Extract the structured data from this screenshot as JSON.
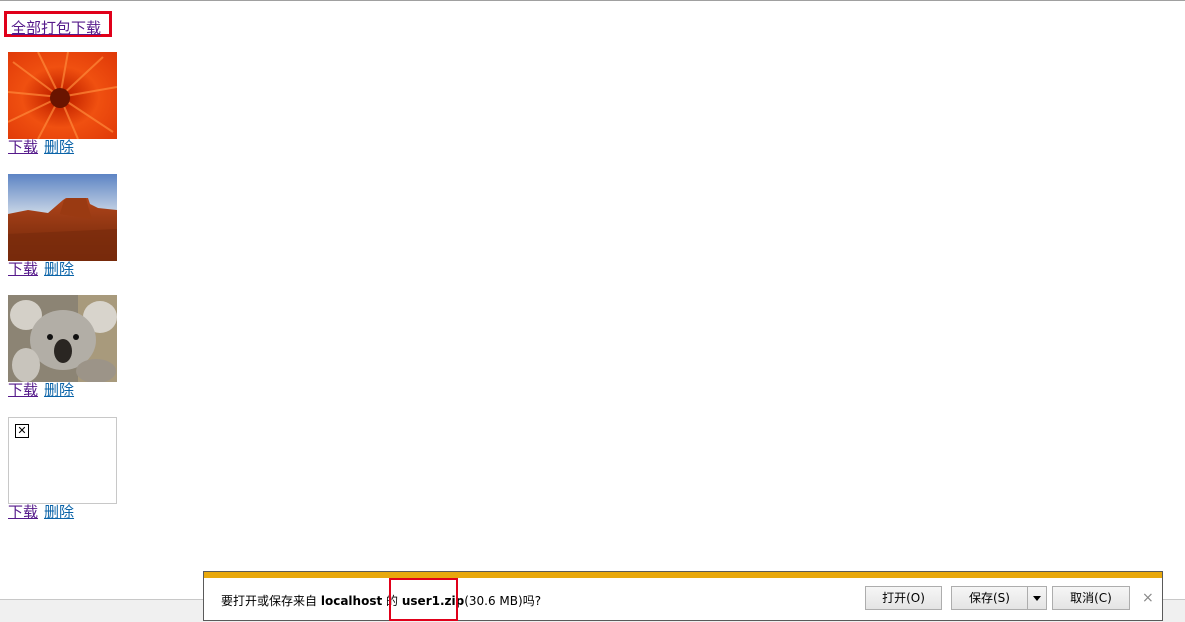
{
  "page": {
    "download_all_label": "全部打包下载",
    "items": [
      {
        "image": "red-chrysanthemum-photo",
        "download_label": "下载",
        "delete_label": "删除"
      },
      {
        "image": "desert-mesa-photo",
        "download_label": "下载",
        "delete_label": "删除"
      },
      {
        "image": "koala-photo",
        "download_label": "下载",
        "delete_label": "删除"
      },
      {
        "image": "broken-image-icon",
        "download_label": "下载",
        "delete_label": "删除"
      }
    ]
  },
  "notification": {
    "prefix": "要打开或保存来自",
    "host": "localhost",
    "of": "的",
    "filename": "user1.zip",
    "size_text": "(30.6 MB)吗?",
    "open_label": "打开(O)",
    "save_label": "保存(S)",
    "cancel_label": "取消(C)",
    "close_glyph": "×",
    "accent_color": "#e8a80c",
    "highlight_color": "#e0001a"
  }
}
